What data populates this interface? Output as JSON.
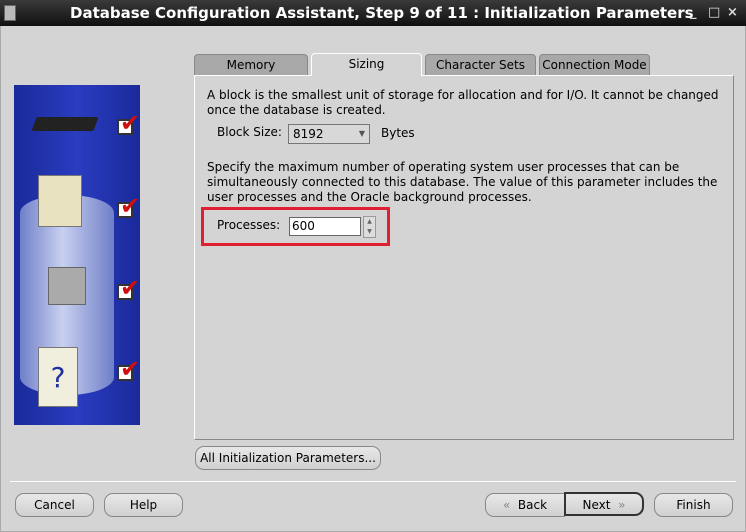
{
  "window": {
    "title": "Database Configuration Assistant, Step 9 of 11 : Initialization Parameters",
    "minimize": "_",
    "maximize": "□",
    "close": "×"
  },
  "tabs": [
    {
      "label": "Memory"
    },
    {
      "label": "Sizing",
      "active": true
    },
    {
      "label": "Character Sets"
    },
    {
      "label": "Connection Mode"
    }
  ],
  "sizing": {
    "block_description": "A block is the smallest unit of storage for allocation and for I/O. It cannot be changed once the database is created.",
    "block_size_label": "Block Size:",
    "block_size_value": "8192",
    "block_size_unit": "Bytes",
    "processes_description": "Specify the maximum number of operating system user processes that can be simultaneously connected to this database. The value of this parameter includes the user processes and the Oracle background processes.",
    "processes_label": "Processes:",
    "processes_value": "600"
  },
  "all_params_button": "All Initialization Parameters...",
  "footer": {
    "cancel": "Cancel",
    "help": "Help",
    "back": "Back",
    "next": "Next",
    "finish": "Finish",
    "back_icon": "«",
    "next_icon": "»"
  },
  "steps_checked": [
    "✔",
    "✔",
    "✔",
    "✔"
  ],
  "colors": {
    "highlight": "#e02030",
    "check": "#d01010",
    "sidebar": "#2a3cc0"
  }
}
